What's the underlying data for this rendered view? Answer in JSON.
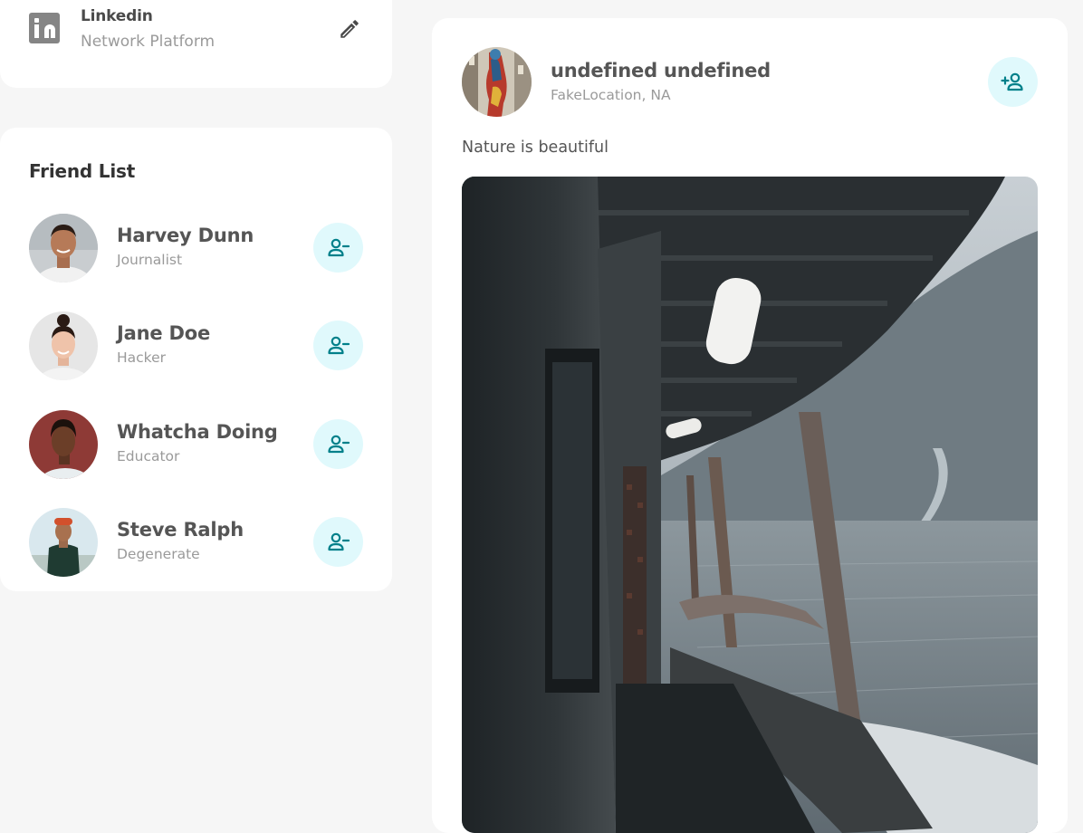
{
  "social": {
    "name": "Linkedin",
    "subtitle": "Network Platform",
    "logo_icon": "linkedin-icon",
    "edit_icon": "pencil-icon"
  },
  "friend_list": {
    "title": "Friend List",
    "friends": [
      {
        "name": "Harvey Dunn",
        "role": "Journalist",
        "action_icon": "remove-friend-icon"
      },
      {
        "name": "Jane Doe",
        "role": "Hacker",
        "action_icon": "remove-friend-icon"
      },
      {
        "name": "Whatcha Doing",
        "role": "Educator",
        "action_icon": "remove-friend-icon"
      },
      {
        "name": "Steve Ralph",
        "role": "Degenerate",
        "action_icon": "remove-friend-icon"
      }
    ]
  },
  "post": {
    "author": "undefined undefined",
    "location": "FakeLocation, NA",
    "text": "Nature is beautiful",
    "action_icon": "add-friend-icon",
    "image_subject": "boat-deck-on-water-photo"
  },
  "colors": {
    "background": "#f6f6f6",
    "card": "#ffffff",
    "accent": "#00808a",
    "accent_bg": "#e0f9fc",
    "text_primary": "#555555",
    "text_muted": "#9a9a9a"
  }
}
